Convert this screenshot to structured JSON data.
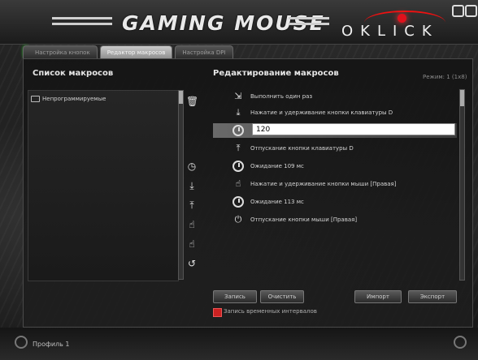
{
  "app": {
    "title": "GAMING MOUSE",
    "brand": "OKLICK"
  },
  "tabs": [
    {
      "label": "Настройка кнопок",
      "active": false
    },
    {
      "label": "Редактор макросов",
      "active": true
    },
    {
      "label": "Настройка DPI",
      "active": false
    }
  ],
  "left_panel": {
    "header": "Список макросов",
    "items": [
      {
        "label": "Непрограммируемые"
      }
    ]
  },
  "right_panel": {
    "header": "Редактирование макросов",
    "summary": "Режим: 1 (1x8)",
    "steps": [
      {
        "icon": "cursor-icon",
        "text": "Выполнить один раз"
      },
      {
        "icon": "key-down-icon",
        "text": "Нажатие и удерживание кнопки клавиатуры D"
      },
      {
        "icon": "clock-icon",
        "text": "120",
        "editing": true
      },
      {
        "icon": "key-up-icon",
        "text": "Отпускание кнопки клавиатуры D"
      },
      {
        "icon": "clock-icon",
        "text": "Ожидание 109 мс"
      },
      {
        "icon": "mouse-down-icon",
        "text": "Нажатие и удерживание кнопки мыши [Правая]"
      },
      {
        "icon": "clock-icon",
        "text": "Ожидание 113 мс"
      },
      {
        "icon": "mouse-up-icon",
        "text": "Отпускание кнопки мыши [Правая]"
      }
    ]
  },
  "buttons": {
    "record": "Запись",
    "clear": "Очистить",
    "import": "Импорт",
    "export": "Экспорт"
  },
  "checkbox": {
    "label": "Запись временных интервалов",
    "checked": true
  },
  "status": {
    "text": "Профиль 1"
  },
  "colors": {
    "accent": "#e1111c",
    "active_indicator": "#3fd13f"
  }
}
